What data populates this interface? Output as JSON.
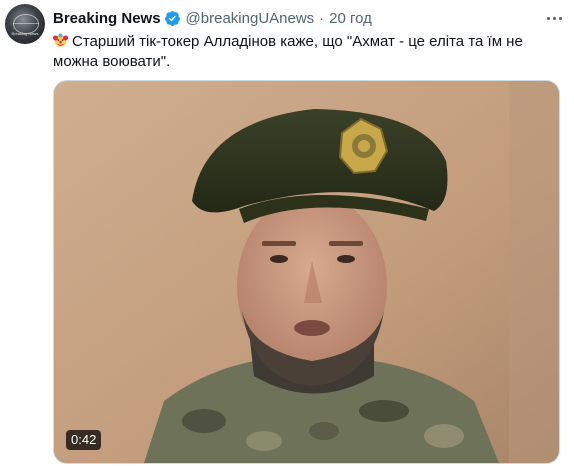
{
  "tweet": {
    "author_name": "Breaking News",
    "handle": "@breakingUAnews",
    "separator": "·",
    "time": "20 год",
    "avatar_caption": "Breaking News",
    "text": "Старший тік-токер Алладінов каже, що \"Ахмат - це еліта та їм не можна воювати\".",
    "emoji": "clown-face-icon",
    "video_duration": "0:42"
  },
  "colors": {
    "verified_badge": "#1d9bf0",
    "secondary_text": "#536471",
    "primary_text": "#0f1419"
  }
}
